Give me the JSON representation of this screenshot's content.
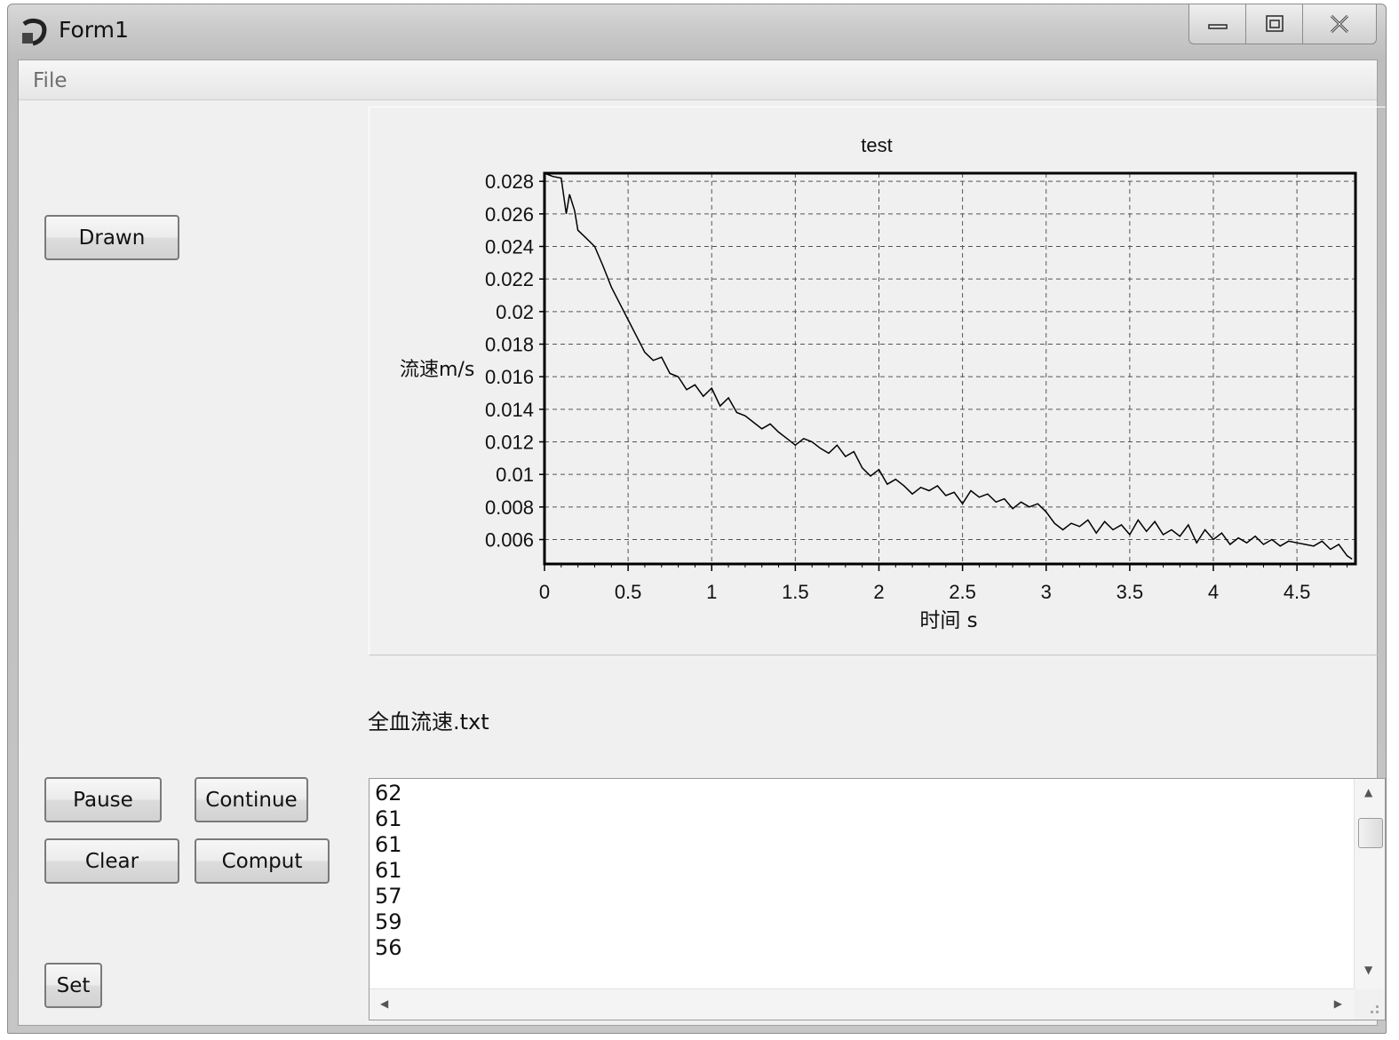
{
  "window": {
    "title": "Form1"
  },
  "menu": {
    "file": "File"
  },
  "buttons": {
    "drawn": "Drawn",
    "pause": "Pause",
    "continue": "Continue",
    "clear": "Clear",
    "comput": "Comput",
    "set": "Set"
  },
  "file_label": "全血流速.txt",
  "text_lines": [
    "62",
    "61",
    "61",
    "61",
    "57",
    "59",
    "56"
  ],
  "icons": [
    "app-icon",
    "minimize-icon",
    "maximize-icon",
    "close-icon",
    "scroll-up-icon",
    "scroll-down-icon",
    "scroll-left-icon",
    "scroll-right-icon",
    "resize-grip-icon"
  ],
  "chart_data": {
    "type": "line",
    "title": "test",
    "xlabel": "时间 s",
    "ylabel": "流速m/s",
    "xlim": [
      0,
      4.85
    ],
    "ylim": [
      0.0045,
      0.0285
    ],
    "xticks": [
      "0",
      "0.5",
      "1",
      "1.5",
      "2",
      "2.5",
      "3",
      "3.5",
      "4",
      "4.5"
    ],
    "yticks": [
      "0.006",
      "0.008",
      "0.01",
      "0.012",
      "0.014",
      "0.016",
      "0.018",
      "0.02",
      "0.022",
      "0.024",
      "0.026",
      "0.028"
    ],
    "grid": true,
    "line_color": "#000000",
    "series": [
      {
        "x": [
          0,
          0.05,
          0.1,
          0.13,
          0.15,
          0.18,
          0.2,
          0.25,
          0.3,
          0.35,
          0.4,
          0.45,
          0.5,
          0.55,
          0.6,
          0.65,
          0.7,
          0.75,
          0.8,
          0.85,
          0.9,
          0.95,
          1.0,
          1.05,
          1.1,
          1.15,
          1.2,
          1.25,
          1.3,
          1.35,
          1.4,
          1.45,
          1.5,
          1.55,
          1.6,
          1.65,
          1.7,
          1.75,
          1.8,
          1.85,
          1.9,
          1.95,
          2.0,
          2.05,
          2.1,
          2.15,
          2.2,
          2.25,
          2.3,
          2.35,
          2.4,
          2.45,
          2.5,
          2.55,
          2.6,
          2.65,
          2.7,
          2.75,
          2.8,
          2.85,
          2.9,
          2.95,
          3.0,
          3.05,
          3.1,
          3.15,
          3.2,
          3.25,
          3.3,
          3.35,
          3.4,
          3.45,
          3.5,
          3.55,
          3.6,
          3.65,
          3.7,
          3.75,
          3.8,
          3.85,
          3.9,
          3.95,
          4.0,
          4.05,
          4.1,
          4.15,
          4.2,
          4.25,
          4.3,
          4.35,
          4.4,
          4.45,
          4.5,
          4.55,
          4.6,
          4.65,
          4.7,
          4.75,
          4.8,
          4.83
        ],
        "y": [
          0.0285,
          0.0283,
          0.0282,
          0.026,
          0.0272,
          0.0262,
          0.025,
          0.0245,
          0.024,
          0.0228,
          0.0215,
          0.0205,
          0.0195,
          0.0185,
          0.0175,
          0.017,
          0.0172,
          0.0162,
          0.016,
          0.0152,
          0.0155,
          0.0148,
          0.0153,
          0.0142,
          0.0147,
          0.0138,
          0.0136,
          0.0132,
          0.0128,
          0.0131,
          0.0126,
          0.0122,
          0.0118,
          0.0122,
          0.012,
          0.0116,
          0.0113,
          0.0118,
          0.0111,
          0.0114,
          0.0104,
          0.0099,
          0.0103,
          0.0094,
          0.0097,
          0.0093,
          0.0088,
          0.0092,
          0.009,
          0.0093,
          0.0087,
          0.0089,
          0.0082,
          0.009,
          0.0086,
          0.0088,
          0.0083,
          0.0085,
          0.0079,
          0.0083,
          0.008,
          0.0082,
          0.0077,
          0.007,
          0.0066,
          0.007,
          0.0068,
          0.0072,
          0.0064,
          0.0071,
          0.0066,
          0.0069,
          0.0063,
          0.0072,
          0.0065,
          0.0071,
          0.0063,
          0.0066,
          0.0062,
          0.0069,
          0.0058,
          0.0066,
          0.006,
          0.0064,
          0.0057,
          0.0061,
          0.0058,
          0.0062,
          0.0057,
          0.006,
          0.0056,
          0.0059,
          0.0058,
          0.0057,
          0.0056,
          0.0059,
          0.0054,
          0.0057,
          0.005,
          0.0048
        ]
      }
    ]
  }
}
